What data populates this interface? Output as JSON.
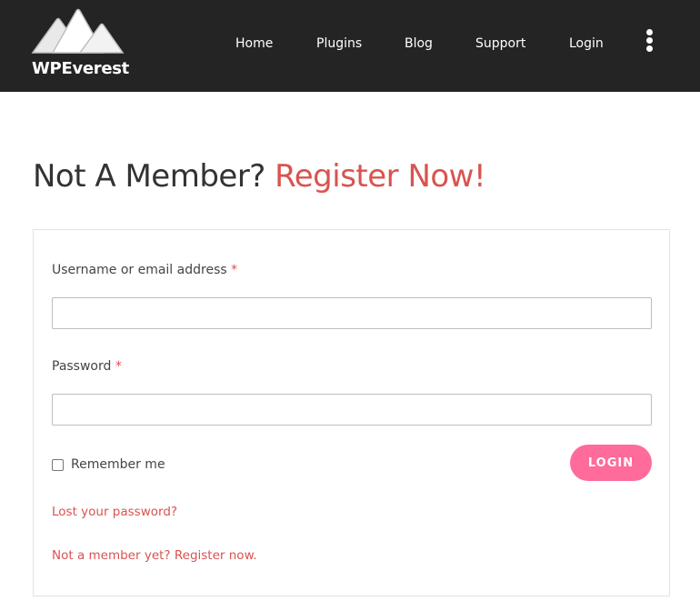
{
  "header": {
    "brand": "WPEverest",
    "nav": [
      {
        "label": "Home"
      },
      {
        "label": "Plugins"
      },
      {
        "label": "Blog"
      },
      {
        "label": "Support"
      },
      {
        "label": "Login"
      }
    ],
    "menu_icon": "kebab-menu-icon",
    "background_color": "#242424"
  },
  "main": {
    "heading_prefix": "Not A Member?",
    "heading_accent": "Register Now!",
    "accent_color": "#d9534f"
  },
  "form": {
    "username_label": "Username or email address",
    "password_label": "Password",
    "required_mark": "*",
    "username_value": "",
    "password_value": "",
    "remember_label": "Remember me",
    "remember_checked": false,
    "login_button": "LOGIN",
    "login_button_color": "#ff6b9a",
    "lost_password_link": "Lost your password?",
    "register_link": "Not a member yet? Register now."
  }
}
